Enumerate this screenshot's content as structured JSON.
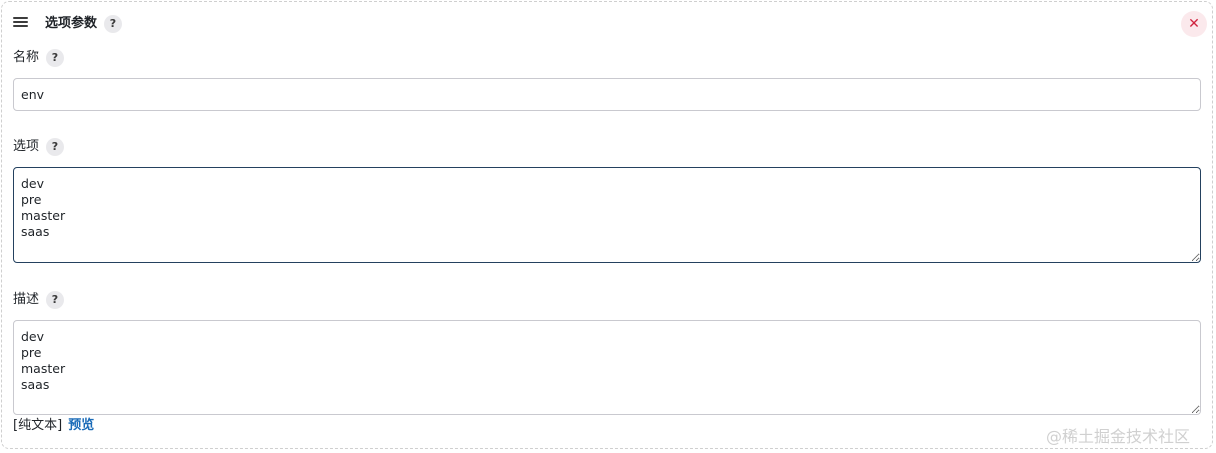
{
  "header": {
    "title": "选项参数",
    "help_glyph": "?",
    "close_glyph": "✕"
  },
  "name_field": {
    "label": "名称",
    "value": "env"
  },
  "choices_field": {
    "label": "选项",
    "value": "dev\npre\nmaster\nsaas"
  },
  "description_field": {
    "label": "描述",
    "value": "dev\npre\nmaster\nsaas"
  },
  "footer": {
    "format_text": "[纯文本]",
    "preview_link": "预览"
  },
  "watermark": "@稀土掘金技术社区",
  "colors": {
    "accent_link": "#1a6bb8",
    "close_icon": "#d0243f",
    "close_bg": "#fbe9ec",
    "focused_border": "#24415f"
  }
}
